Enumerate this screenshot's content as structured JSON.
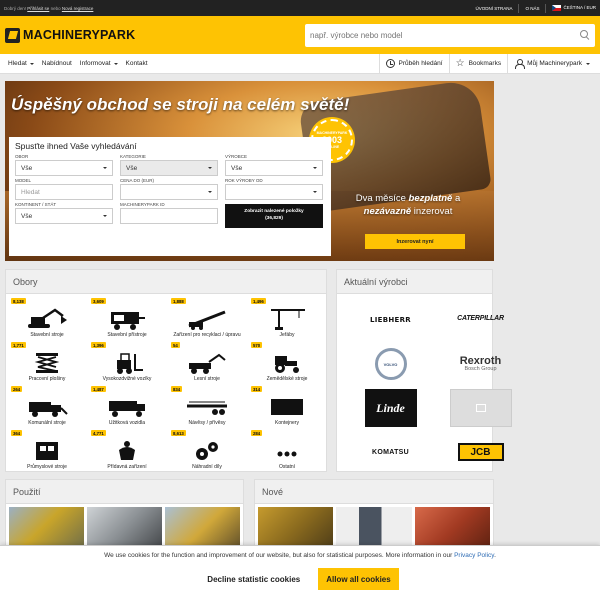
{
  "topbar": {
    "left_prefix": "Dobrý den!",
    "login_link": "Přihlásit se",
    "middle": "nebo",
    "register_link": "Nová registrace",
    "links": [
      "ÚVODNÍ STRANA",
      "O NÁS"
    ],
    "locale": "ČEŠTINA / EUR"
  },
  "header": {
    "logo_text": "MACHINERYPARK",
    "search_placeholder": "např. výrobce nebo model"
  },
  "nav": {
    "items": [
      {
        "label": "Hledat",
        "dropdown": true
      },
      {
        "label": "Nabídnout",
        "dropdown": false
      },
      {
        "label": "Informovat",
        "dropdown": true
      },
      {
        "label": "Kontakt",
        "dropdown": false
      }
    ],
    "history": "Průběh hledání",
    "bookmarks": "Bookmarks",
    "account": "Můj Machinerypark"
  },
  "hero": {
    "title": "Úspěšný obchod se stroji na celém světě!",
    "seal_small_top": "MACHINERYPARK",
    "seal_year": "2003",
    "seal_small_bottom": "ON-LINE",
    "panel_title": "Spusťte ihned Vaše vyhledávání",
    "fields": {
      "obor_label": "OBOR",
      "obor_value": "Vše",
      "kategorie_label": "KATEGORIE",
      "kategorie_value": "Vše",
      "vyrobce_label": "VÝROBCE",
      "vyrobce_value": "Vše",
      "model_label": "MODEL",
      "model_placeholder": "Hledat",
      "cena_label": "CENA DO (EUR)",
      "rok_label": "ROK VÝROBY OD",
      "kontinent_label": "KONTINENT / STÁT",
      "kontinent_value": "Vše",
      "id_label": "MACHINERYPARK ID"
    },
    "submit_line1": "Zobrazit nalezené položky",
    "submit_line2": "(36,829)",
    "promo_prefix": "Dva měsíce ",
    "promo_bold1": "bezplatně",
    "promo_mid": " a ",
    "promo_bold2": "nezávazně",
    "promo_suffix": " inzerovat",
    "promo_button": "Inzerovat nyní"
  },
  "obory": {
    "title": "Obory",
    "items": [
      {
        "count": "8,138",
        "label": "Stavební stroje",
        "icon": "excavator-icon"
      },
      {
        "count": "3,609",
        "label": "Stavební přístroje",
        "icon": "generator-icon"
      },
      {
        "count": "1,888",
        "label": "Zařízení pro recyklaci / úpravu",
        "icon": "conveyor-icon"
      },
      {
        "count": "1,496",
        "label": "Jeřáby",
        "icon": "crane-icon"
      },
      {
        "count": "1,771",
        "label": "Pracovní plošiny",
        "icon": "scissor-lift-icon"
      },
      {
        "count": "1,396",
        "label": "Vysokozdvižné vozíky",
        "icon": "forklift-icon"
      },
      {
        "count": "54",
        "label": "Lesní stroje",
        "icon": "forestry-icon"
      },
      {
        "count": "570",
        "label": "Zemědělské stroje",
        "icon": "tractor-icon"
      },
      {
        "count": "264",
        "label": "Komunální stroje",
        "icon": "municipal-icon"
      },
      {
        "count": "1,487",
        "label": "Užitková vozidla",
        "icon": "truck-icon"
      },
      {
        "count": "834",
        "label": "Návěsy / přívěsy",
        "icon": "trailer-icon"
      },
      {
        "count": "314",
        "label": "Kontejnery",
        "icon": "container-icon"
      },
      {
        "count": "364",
        "label": "Průmyslové stroje",
        "icon": "industrial-icon"
      },
      {
        "count": "4,771",
        "label": "Přídavná zařízení",
        "icon": "attachment-icon"
      },
      {
        "count": "8,613",
        "label": "Náhradní díly",
        "icon": "gears-icon"
      },
      {
        "count": "284",
        "label": "Ostatní",
        "icon": "more-icon"
      }
    ]
  },
  "vyrobci": {
    "title": "Aktuální výrobci",
    "brands": [
      {
        "name": "LIEBHERR",
        "style": "liebherr"
      },
      {
        "name": "CATERPILLAR",
        "style": "cat"
      },
      {
        "name": "VOLVO",
        "style": "volvo"
      },
      {
        "name": "Rexroth",
        "sub": "Bosch Group",
        "style": "rexroth"
      },
      {
        "name": "Linde",
        "style": "linde"
      },
      {
        "name": "",
        "style": "placeholder"
      },
      {
        "name": "KOMATSU",
        "style": "komatsu"
      },
      {
        "name": "JCB",
        "style": "jcb"
      }
    ]
  },
  "pouziti": {
    "title": "Použití"
  },
  "nove": {
    "title": "Nové"
  },
  "cookie": {
    "text": "We use cookies for the function and improvement of our website, but also for statistical purposes. More information in our ",
    "link": "Privacy Policy",
    "after_link": ".",
    "decline": "Decline statistic cookies",
    "accept": "Allow all cookies"
  },
  "colors": {
    "brand_yellow": "#fec303",
    "dark": "#222222"
  }
}
